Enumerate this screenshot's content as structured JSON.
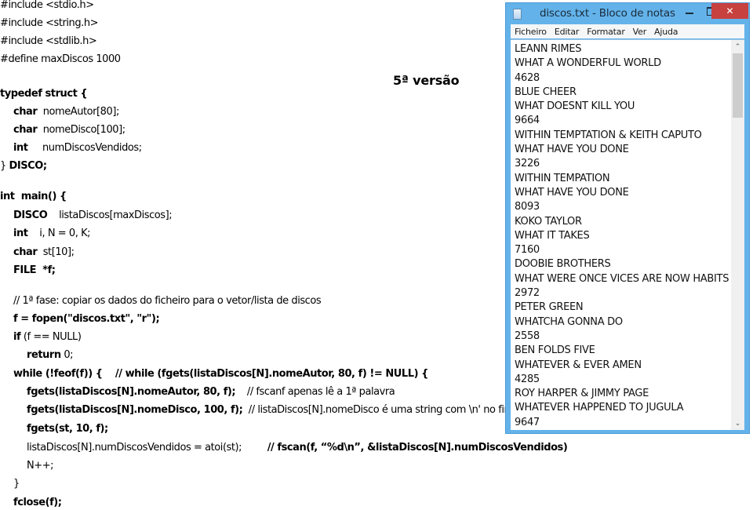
{
  "slide": {
    "version_label": "5ª versão",
    "code_lines": [
      {
        "indent": 0,
        "segments": [
          {
            "t": "#include <stdio.h>",
            "w": "n"
          }
        ]
      },
      {
        "indent": 0,
        "segments": [
          {
            "t": "#include <string.h>",
            "w": "n"
          }
        ]
      },
      {
        "indent": 0,
        "segments": [
          {
            "t": "#include <stdlib.h>",
            "w": "n"
          }
        ]
      },
      {
        "indent": 0,
        "segments": [
          {
            "t": "#define maxDiscos 1000",
            "w": "n"
          }
        ]
      },
      {
        "indent": 0,
        "segments": [
          {
            "t": "",
            "w": "n"
          }
        ]
      },
      {
        "indent": 0,
        "segments": [
          {
            "t": "typedef struct {",
            "w": "b"
          }
        ]
      },
      {
        "indent": 1,
        "segments": [
          {
            "t": "char",
            "w": "b"
          },
          {
            "t": "  nomeAutor[80];",
            "w": "n"
          }
        ]
      },
      {
        "indent": 1,
        "segments": [
          {
            "t": "char",
            "w": "b"
          },
          {
            "t": "  nomeDisco[100];",
            "w": "n"
          }
        ]
      },
      {
        "indent": 1,
        "segments": [
          {
            "t": "int",
            "w": "b"
          },
          {
            "t": "     numDiscosVendidos;",
            "w": "n"
          }
        ]
      },
      {
        "indent": 0,
        "segments": [
          {
            "t": "} ",
            "w": "n"
          },
          {
            "t": "DISCO;",
            "w": "b"
          }
        ]
      },
      {
        "indent": 0,
        "segments": [
          {
            "t": "",
            "w": "n"
          }
        ]
      },
      {
        "indent": 0,
        "segments": [
          {
            "t": "int  main() {",
            "w": "b"
          }
        ]
      },
      {
        "indent": 1,
        "segments": [
          {
            "t": "DISCO",
            "w": "b"
          },
          {
            "t": "    listaDiscos[maxDiscos];",
            "w": "n"
          }
        ]
      },
      {
        "indent": 1,
        "segments": [
          {
            "t": "int",
            "w": "b"
          },
          {
            "t": "    i, N = 0, K;",
            "w": "n"
          }
        ]
      },
      {
        "indent": 1,
        "segments": [
          {
            "t": "char",
            "w": "b"
          },
          {
            "t": "  st[10];",
            "w": "n"
          }
        ]
      },
      {
        "indent": 1,
        "segments": [
          {
            "t": "FILE  *f;",
            "w": "b"
          }
        ]
      },
      {
        "indent": 0,
        "segments": [
          {
            "t": "",
            "w": "n"
          }
        ]
      },
      {
        "indent": 1,
        "segments": [
          {
            "t": "// 1ª fase: copiar os dados do ficheiro para o vetor/lista de discos",
            "w": "n"
          }
        ]
      },
      {
        "indent": 1,
        "segments": [
          {
            "t": "f = fopen(\"discos.txt\", \"r\");",
            "w": "b"
          }
        ]
      },
      {
        "indent": 1,
        "segments": [
          {
            "t": "if",
            "w": "b"
          },
          {
            "t": " (f == NULL)",
            "w": "n"
          }
        ]
      },
      {
        "indent": 2,
        "segments": [
          {
            "t": "return",
            "w": "b"
          },
          {
            "t": " 0;",
            "w": "n"
          }
        ]
      },
      {
        "indent": 1,
        "segments": [
          {
            "t": "while (!feof(f)) {",
            "w": "b"
          },
          {
            "t": "    // while (fgets(listaDiscos[N].nomeAutor, 80, f) != NULL) {",
            "w": "b"
          }
        ]
      },
      {
        "indent": 2,
        "segments": [
          {
            "t": "fgets(listaDiscos[N].nomeAutor, 80, f);",
            "w": "b"
          },
          {
            "t": "    // fscanf apenas lê a 1ª palavra",
            "w": "n"
          }
        ]
      },
      {
        "indent": 2,
        "segments": [
          {
            "t": "fgets(listaDiscos[N].nomeDisco, 100, f);",
            "w": "b"
          },
          {
            "t": "  // listaDiscos[N].nomeDisco é uma string com \\n' no fim",
            "w": "n"
          }
        ]
      },
      {
        "indent": 2,
        "segments": [
          {
            "t": "fgets(st, 10, f);",
            "w": "b"
          }
        ]
      },
      {
        "indent": 2,
        "segments": [
          {
            "t": "listaDiscos[N].numDiscosVendidos = atoi(st);",
            "w": "n"
          },
          {
            "t": "        // fscan(f, “%d\\n”, &listaDiscos[N].numDiscosVendidos)",
            "w": "b"
          }
        ]
      },
      {
        "indent": 2,
        "segments": [
          {
            "t": "N++;",
            "w": "n"
          }
        ]
      },
      {
        "indent": 1,
        "segments": [
          {
            "t": "}",
            "w": "n"
          }
        ]
      },
      {
        "indent": 1,
        "segments": [
          {
            "t": "fclose(f);",
            "w": "b"
          }
        ]
      }
    ]
  },
  "notepad": {
    "title": "discos.txt - Bloco de notas",
    "close_label": "✕",
    "menu": [
      "Ficheiro",
      "Editar",
      "Formatar",
      "Ver",
      "Ajuda"
    ],
    "scroll_up_glyph": "⌃",
    "scroll_down_glyph": "⌄",
    "lines": [
      "LEANN RIMES",
      "WHAT A WONDERFUL WORLD",
      "4628",
      "BLUE CHEER",
      "WHAT DOESNT KILL YOU",
      "9664",
      "WITHIN TEMPTATION & KEITH CAPUTO",
      "WHAT HAVE YOU DONE",
      "3226",
      "WITHIN TEMPATION",
      "WHAT HAVE YOU DONE",
      "8093",
      "KOKO TAYLOR",
      "WHAT IT TAKES",
      "7160",
      "DOOBIE BROTHERS",
      "WHAT WERE ONCE VICES ARE NOW HABITS",
      "2972",
      "PETER GREEN",
      "WHATCHA GONNA DO",
      "2558",
      "BEN FOLDS FIVE",
      "WHATEVER & EVER AMEN",
      "4285",
      "ROY HARPER & JIMMY PAGE",
      "WHATEVER HAPPENED TO JUGULA",
      "9647"
    ]
  }
}
